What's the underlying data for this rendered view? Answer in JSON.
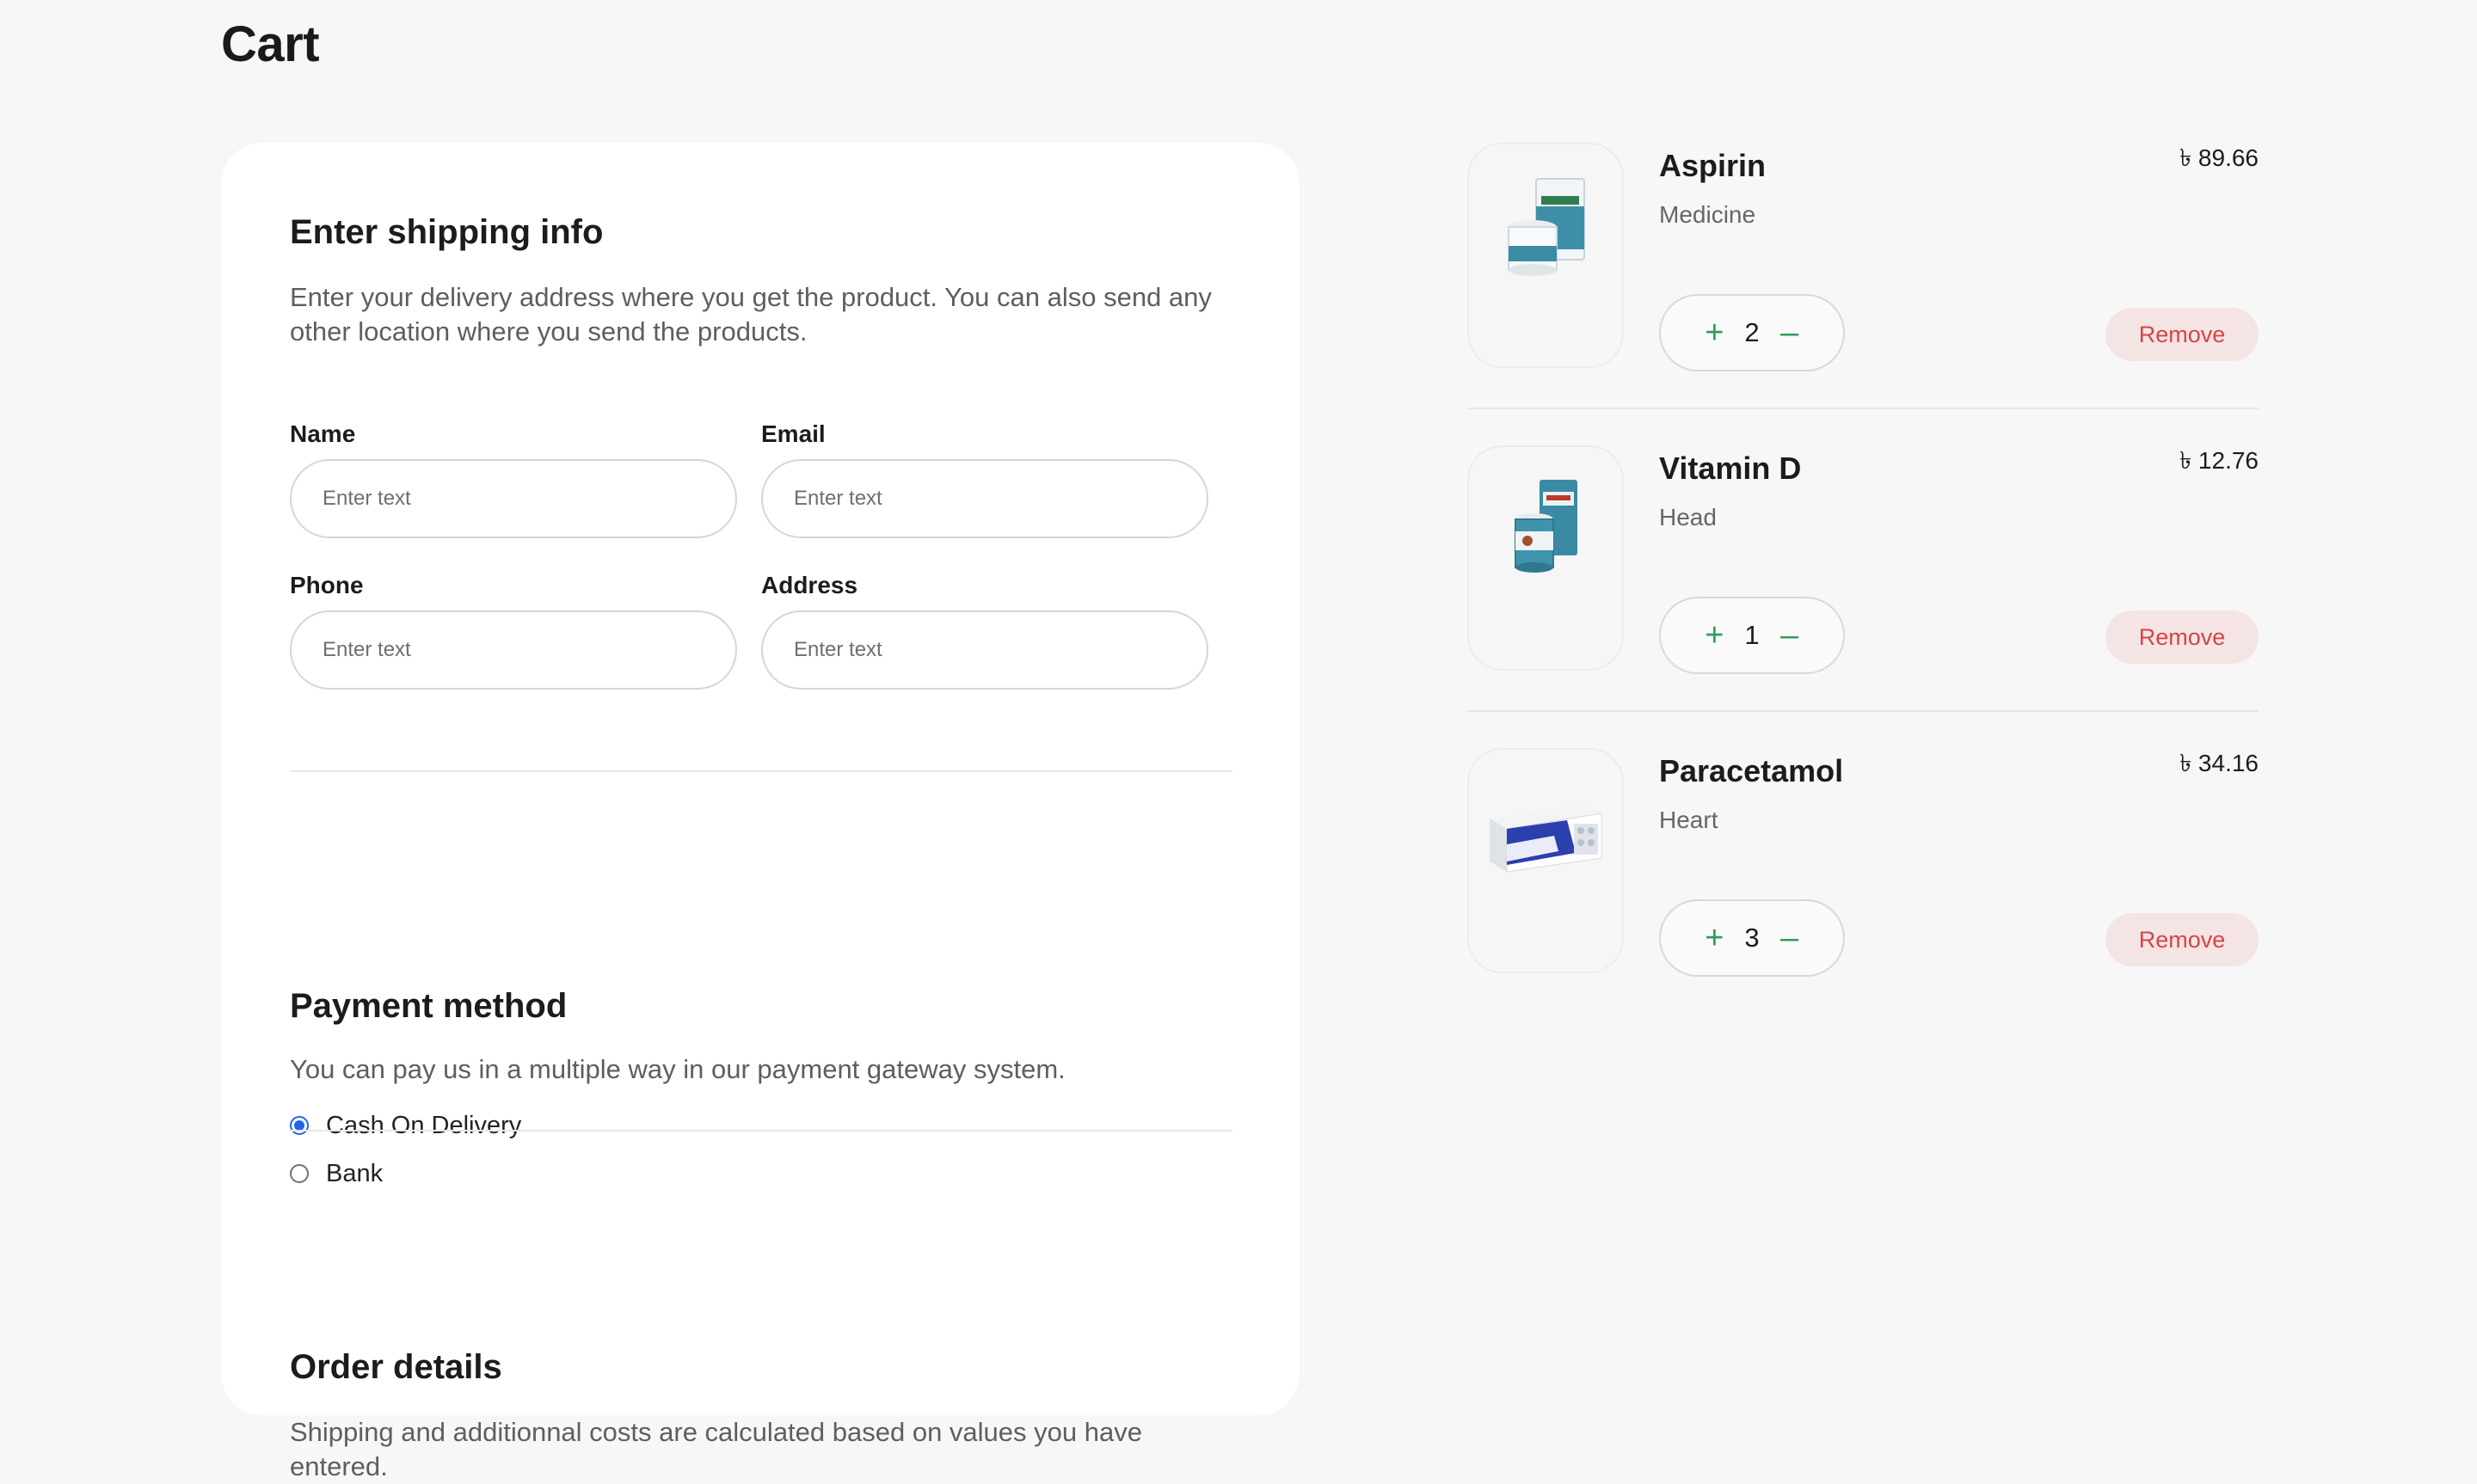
{
  "page": {
    "title": "Cart"
  },
  "shipping": {
    "heading": "Enter shipping info",
    "description": "Enter your delivery address where you get the product. You can also send any other location where you send the products.",
    "fields": [
      {
        "label": "Name",
        "placeholder": "Enter text",
        "value": ""
      },
      {
        "label": "Email",
        "placeholder": "Enter text",
        "value": ""
      },
      {
        "label": "Phone",
        "placeholder": "Enter text",
        "value": ""
      },
      {
        "label": "Address",
        "placeholder": "Enter text",
        "value": ""
      }
    ]
  },
  "payment": {
    "heading": "Payment method",
    "description": "You can pay us in a multiple way in our payment gateway system.",
    "options": [
      {
        "label": "Cash On Delivery",
        "selected": true
      },
      {
        "label": "Bank",
        "selected": false
      }
    ]
  },
  "order": {
    "heading": "Order details",
    "description": "Shipping and additionnal costs are calculated based on values you have entered."
  },
  "cart": {
    "remove_label": "Remove",
    "increment_icon": "plus-icon",
    "decrement_icon": "minus-icon",
    "items": [
      {
        "name": "Aspirin",
        "category": "Medicine",
        "price": "৳ 89.66",
        "quantity": "2",
        "image": "aspirin-product-image"
      },
      {
        "name": "Vitamin D",
        "category": "Head",
        "price": "৳ 12.76",
        "quantity": "1",
        "image": "vitamin-d-product-image"
      },
      {
        "name": "Paracetamol",
        "category": "Heart",
        "price": "৳ 34.16",
        "quantity": "3",
        "image": "paracetamol-product-image"
      }
    ]
  },
  "colors": {
    "accent_green": "#2f9e5a",
    "remove_text": "#d64545",
    "remove_bg": "#f5e4e4",
    "radio_selected": "#2563eb",
    "background": "#f7f7f8"
  }
}
